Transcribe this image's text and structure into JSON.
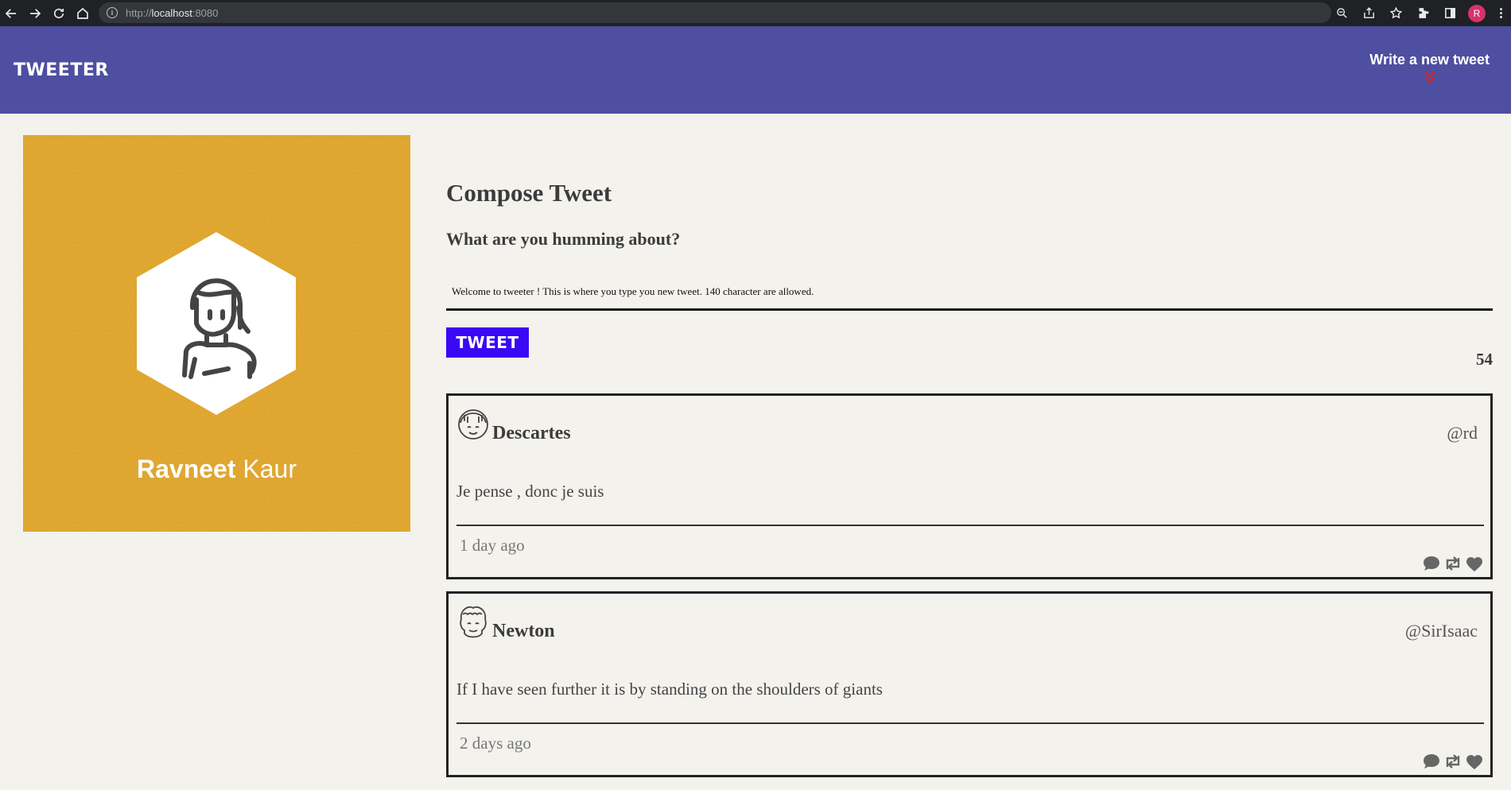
{
  "browser": {
    "url_prefix": "http://",
    "url_host": "localhost",
    "url_port": ":8080",
    "profile_initial": "R"
  },
  "nav": {
    "brand": "TWEETER",
    "write_link": "Write a new tweet"
  },
  "profile": {
    "first_name": "Ravneet",
    "last_name": "Kaur",
    "card_color": "#dfa630"
  },
  "compose": {
    "title": "Compose Tweet",
    "subtitle": "What are you humming about?",
    "input_value": "Welcome to tweeter ! This is where you type you new tweet. 140 character are allowed.",
    "button_label": "TWEET",
    "char_counter": "54"
  },
  "tweets": [
    {
      "name": "Descartes",
      "handle": "@rd",
      "content": "Je pense , donc je suis",
      "time": "1 day ago",
      "icons": [
        "comment-icon",
        "retweet-icon",
        "heart-icon"
      ]
    },
    {
      "name": "Newton",
      "handle": "@SirIsaac",
      "content": "If I have seen further it is by standing on the shoulders of giants",
      "time": "2 days ago",
      "icons": [
        "comment-icon",
        "retweet-icon",
        "heart-icon"
      ]
    }
  ],
  "colors": {
    "nav_bg": "#4e4fa0",
    "tweet_button": "#3a08f5",
    "chevron": "#e02020",
    "page_bg": "#f4f2ed"
  }
}
